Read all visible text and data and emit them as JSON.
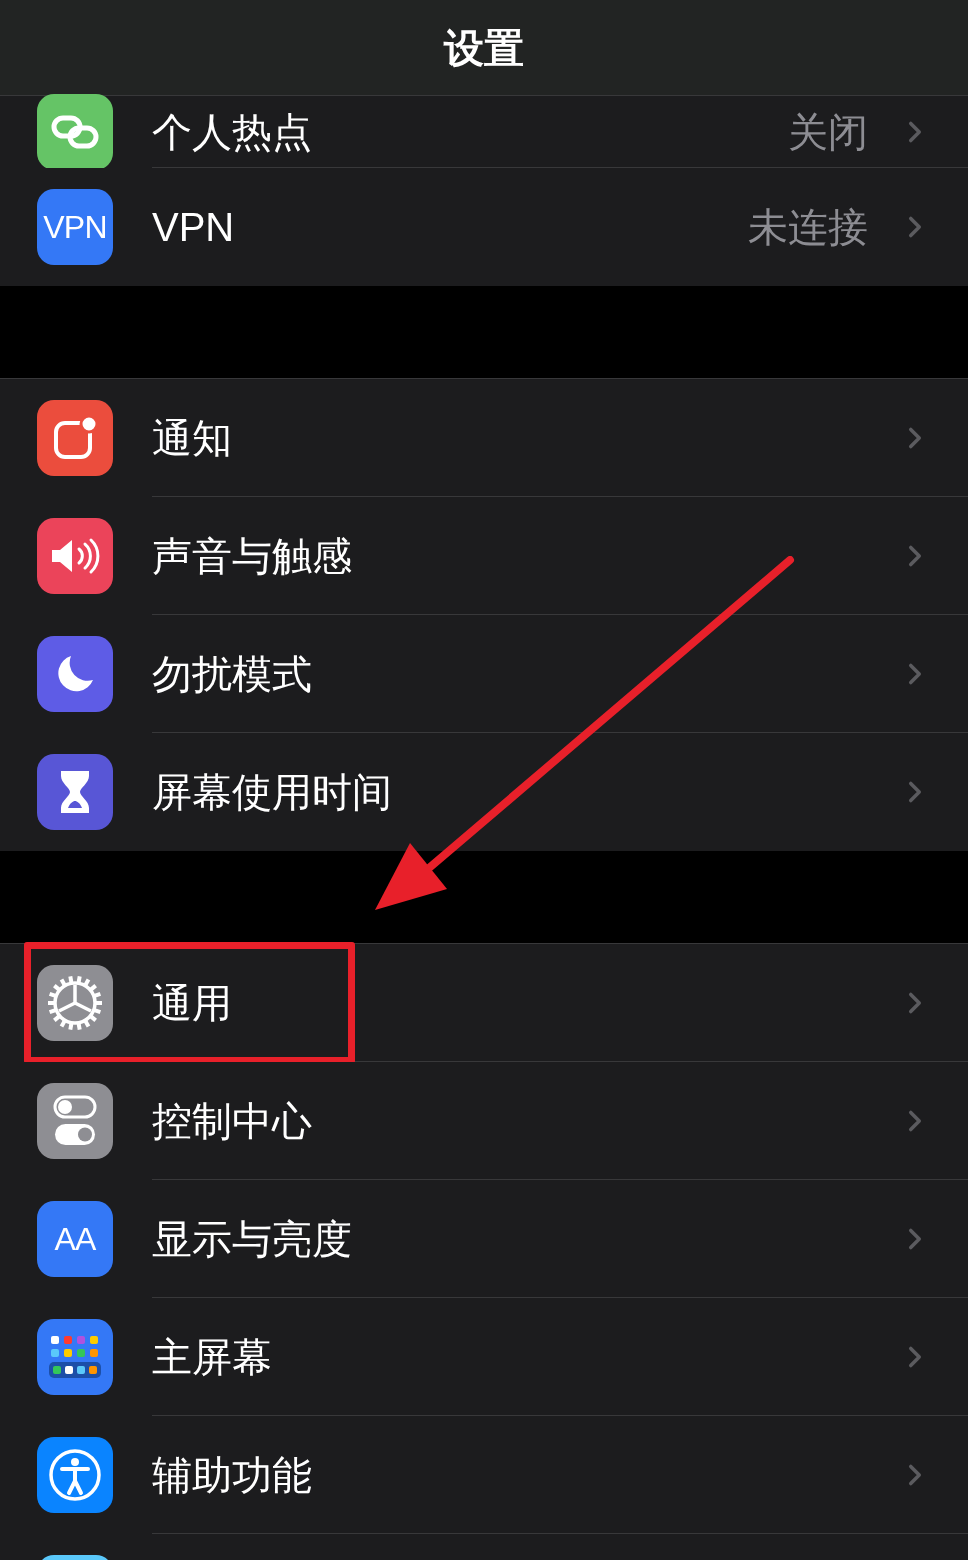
{
  "header": {
    "title": "设置"
  },
  "groups": [
    {
      "items": [
        {
          "kind": "link",
          "color": "#65c466",
          "label": "个人热点",
          "value": "关闭",
          "highlighted": false
        },
        {
          "kind": "text",
          "icon_text": "VPN",
          "color": "#3478f6",
          "label": "VPN",
          "value": "未连接",
          "highlighted": false
        }
      ]
    },
    {
      "items": [
        {
          "kind": "notice",
          "color": "#eb4d3d",
          "label": "通知",
          "highlighted": false
        },
        {
          "kind": "speaker",
          "color": "#eb445a",
          "label": "声音与触感",
          "highlighted": false
        },
        {
          "kind": "moon",
          "color": "#5e5ce6",
          "label": "勿扰模式",
          "highlighted": false
        },
        {
          "kind": "hourglass",
          "color": "#5856d6",
          "label": "屏幕使用时间",
          "highlighted": false
        }
      ]
    },
    {
      "items": [
        {
          "kind": "gear",
          "color": "#8e8e93",
          "label": "通用",
          "highlighted": true
        },
        {
          "kind": "toggles",
          "color": "#8e8e93",
          "label": "控制中心",
          "highlighted": false
        },
        {
          "kind": "text",
          "icon_text": "AA",
          "color": "#3478f6",
          "label": "显示与亮度",
          "highlighted": false
        },
        {
          "kind": "grid",
          "color": "#3478f6",
          "label": "主屏幕",
          "highlighted": false
        },
        {
          "kind": "person",
          "color": "#0a84ff",
          "label": "辅助功能",
          "highlighted": false
        },
        {
          "kind": "blank",
          "color": "#5ac8fa",
          "highlighted": false
        }
      ]
    }
  ]
}
